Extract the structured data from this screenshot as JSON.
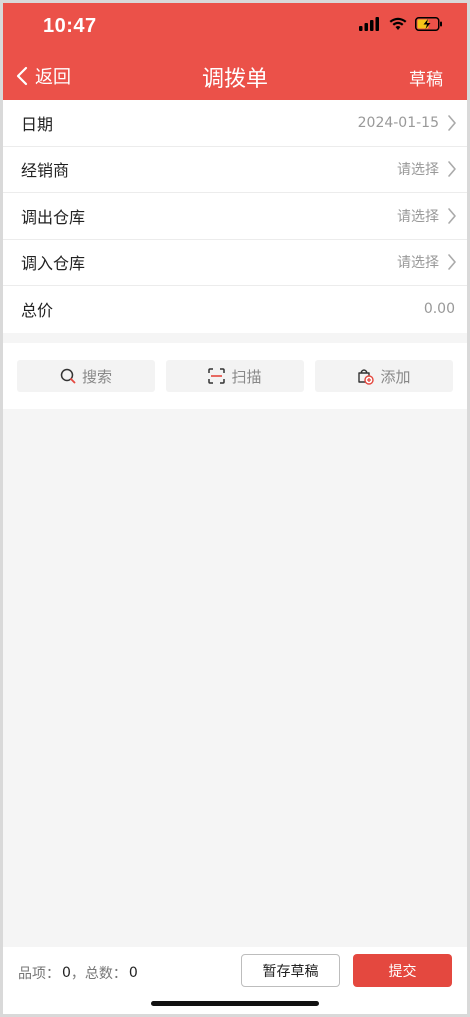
{
  "status_bar": {
    "time": "10:47",
    "icons": [
      "signal-icon",
      "wifi-icon",
      "battery-charging-icon"
    ]
  },
  "nav": {
    "back_label": "返回",
    "title": "调拨单",
    "right_label": "草稿"
  },
  "form": {
    "rows": [
      {
        "label": "日期",
        "value": "2024-01-15"
      },
      {
        "label": "经销商",
        "value": "请选择"
      },
      {
        "label": "调出仓库",
        "value": "请选择"
      },
      {
        "label": "调入仓库",
        "value": "请选择"
      },
      {
        "label": "总价",
        "value": "0.00"
      }
    ]
  },
  "actions": {
    "search_label": "搜索",
    "scan_label": "扫描",
    "add_label": "添加"
  },
  "footer": {
    "items_label": "品项：",
    "items_value": "0",
    "separator": "，",
    "total_label": "总数：",
    "total_value": "0",
    "draft_button": "暂存草稿",
    "submit_button": "提交"
  },
  "colors": {
    "brand": "#eb5149",
    "submit": "#e4483f",
    "background": "#f5f5f5"
  }
}
